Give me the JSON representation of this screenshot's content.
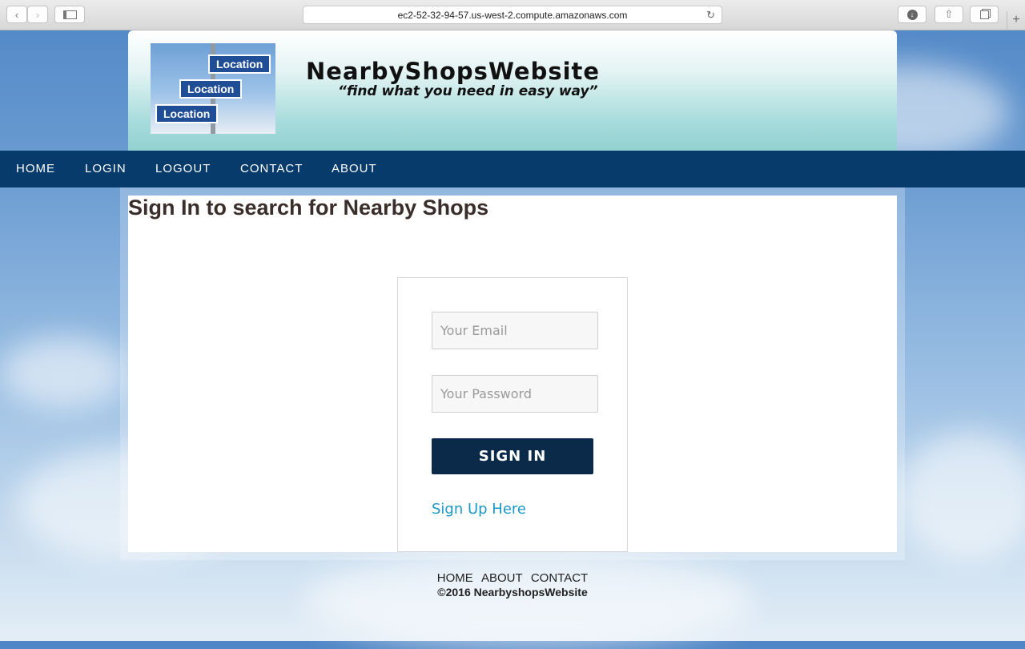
{
  "browser": {
    "url": "ec2-52-32-94-57.us-west-2.compute.amazonaws.com",
    "tab_add_label": "+"
  },
  "header": {
    "logo_signs": [
      "Location",
      "Location",
      "Location"
    ],
    "title": "NearbyShopsWebsite",
    "tagline": "“find what you need in easy way”"
  },
  "nav": {
    "items": [
      "HOME",
      "LOGIN",
      "LOGOUT",
      "CONTACT",
      "ABOUT"
    ]
  },
  "main": {
    "heading": "Sign In to search for Nearby Shops",
    "email_placeholder": "Your Email",
    "password_placeholder": "Your Password",
    "signin_label": "SIGN IN",
    "signup_label": "Sign Up Here"
  },
  "footer": {
    "links": [
      "HOME",
      "ABOUT",
      "CONTACT"
    ],
    "copyright": "©2016 NearbyshopsWebsite"
  },
  "colors": {
    "nav_bg": "#073b6c",
    "button_bg": "#0b2a4a",
    "link": "#1a98c8"
  }
}
